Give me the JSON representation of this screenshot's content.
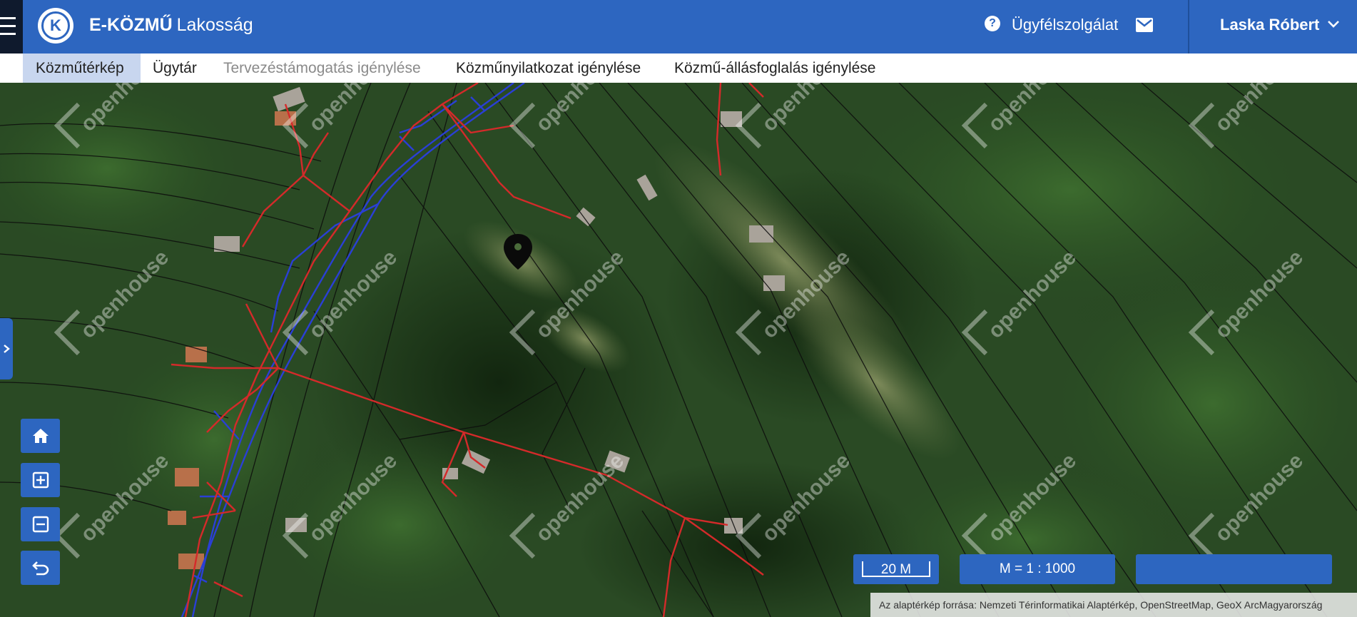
{
  "header": {
    "brand_bold": "E-KÖZMŰ",
    "brand_light": "Lakosság",
    "logo_letter": "K",
    "help_glyph": "?",
    "support_label": "Ügyfélszolgálat",
    "user_name": "Laska Róbert",
    "colors": {
      "bar": "#2d66c0",
      "hamburger_bg": "#0f1a2d"
    }
  },
  "nav": {
    "items": [
      {
        "label": "Közműtérkép",
        "state": "active"
      },
      {
        "label": "Ügytár",
        "state": "normal"
      },
      {
        "label": "Tervezéstámogatás igénylése",
        "state": "disabled"
      },
      {
        "label": "Közműnyilatkozat igénylése",
        "state": "normal"
      },
      {
        "label": "Közmű-állásfoglalás igénylése",
        "state": "normal"
      }
    ]
  },
  "map": {
    "watermark_text": "openhouse",
    "controls": [
      "home-icon",
      "zoom-in-icon",
      "zoom-out-icon",
      "undo-icon"
    ],
    "scale_bar_label": "20 M",
    "scale_ratio_label": "M = 1 : 1000",
    "coordinates_value": "",
    "attribution": "Az alaptérkép forrása: Nemzeti Térinformatikai Alaptérkép, OpenStreetMap, GeoX ArcMagyarország",
    "colors": {
      "electric_line": "#d42a2a",
      "water_line": "#2a3fd6",
      "parcel_line": "#101010",
      "control_bg": "#2d66c0"
    }
  }
}
